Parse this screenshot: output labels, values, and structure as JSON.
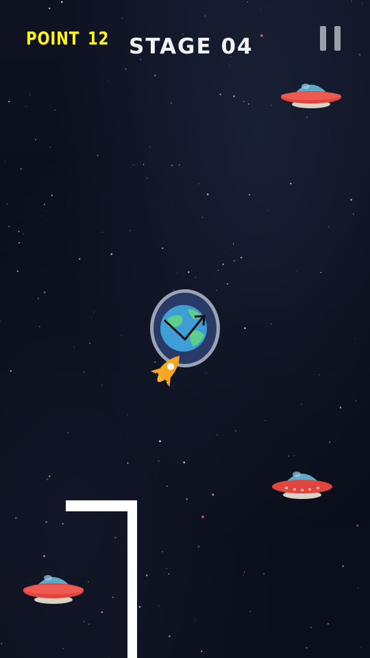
{
  "hud": {
    "point_label": "POINT",
    "point_value": "12",
    "stage_label": "STAGE 04",
    "point_color": "#fff21a",
    "stage_color": "#f1f1f1"
  },
  "controls": {
    "pause_icon": "pause-icon"
  },
  "game_objects": {
    "ufos": [
      "ufo-icon",
      "ufo-icon",
      "ufo-icon"
    ],
    "goal_icon": "planet-earth-icon",
    "goal_ring_color": "#9aa3b5",
    "trajectory_icon": "zigzag-arrow-icon",
    "player_icon": "rocket-icon",
    "player_color": "#f5a623",
    "walls_color": "#ffffff"
  },
  "theme": {
    "background": "#0b0f1c",
    "ufo_dome": "#5ea8c8",
    "ufo_body": "#e0463e",
    "ufo_base": "#d9d3c6"
  }
}
